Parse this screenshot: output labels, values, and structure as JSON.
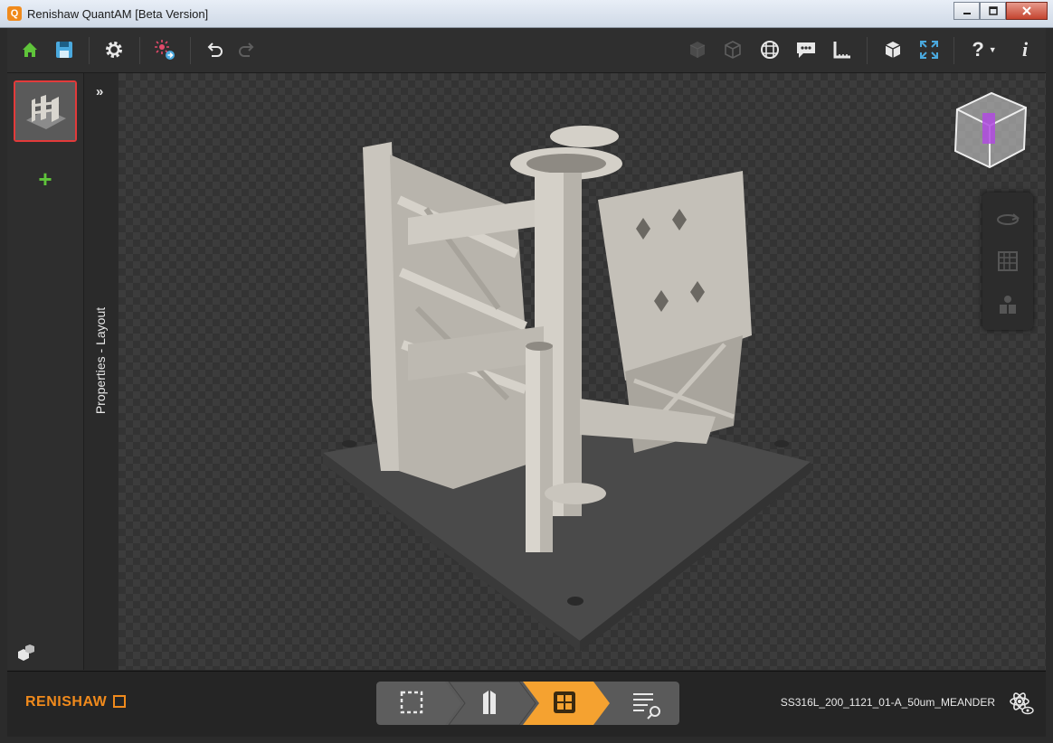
{
  "app": {
    "title": "Renishaw QuantAM [Beta Version]",
    "icon": "q-logo-icon"
  },
  "toolbar": {
    "left_icons": [
      "home-icon",
      "save-icon",
      "gear-icon",
      "laser-icon",
      "undo-icon",
      "redo-icon"
    ],
    "right_icons": [
      "solid-view-icon",
      "cube-view-icon",
      "grid-icon",
      "comment-icon",
      "ruler-icon",
      "box-view-icon",
      "expand-icon",
      "help-icon",
      "info-icon"
    ],
    "help_label": "?",
    "info_label": "i"
  },
  "sidebar": {
    "add_label": "+",
    "footer_icon": "parts-cubes-icon"
  },
  "properties": {
    "label": "Properties - Layout",
    "expand_label": "»"
  },
  "viewport": {
    "view_cube": "view-cube-icon",
    "tools": [
      "rotate-icon",
      "grid-pattern-icon",
      "supports-icon"
    ]
  },
  "bottom": {
    "brand": "RENISHAW",
    "workflow": [
      "layout-step",
      "supports-step",
      "slice-step",
      "review-step"
    ],
    "active_step": 2,
    "filename": "SS316L_200_1121_01-A_50um_MEANDER",
    "status_icon": "atom-eye-icon"
  },
  "colors": {
    "accent": "#f08a1c",
    "home": "#5fc43a",
    "save": "#4aa9de",
    "laser": "#e24a6a",
    "selected_border": "#e23a3a",
    "add": "#5fc43a",
    "part_gray": "#c9c5bd",
    "base_plate": "#4a4a4a"
  }
}
